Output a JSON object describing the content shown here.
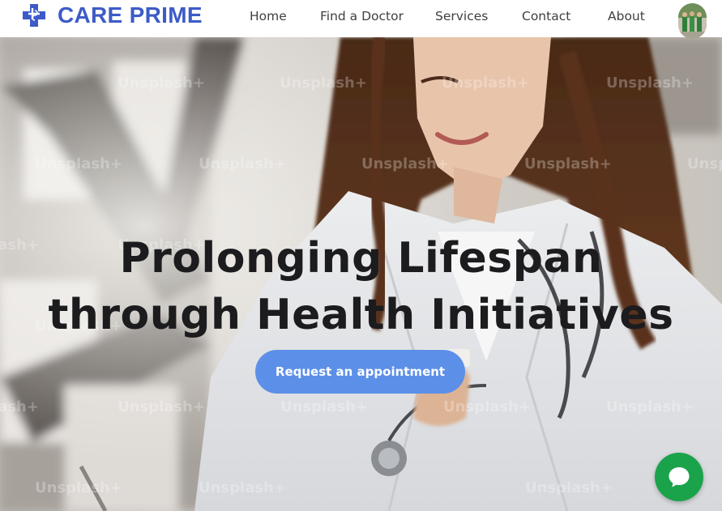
{
  "brand": {
    "name": "CARE PRIME",
    "logo_icon": "medical-cross-icon",
    "color": "#3d5bc7"
  },
  "nav": {
    "items": [
      {
        "label": "Home"
      },
      {
        "label": "Find a Doctor"
      },
      {
        "label": "Services"
      },
      {
        "label": "Contact"
      },
      {
        "label": "About"
      }
    ],
    "avatar_icon": "profile-avatar"
  },
  "hero": {
    "background": "photo-doctor-with-stethoscope",
    "watermark": "Unsplash+",
    "headline_line1": "Prolonging Lifespan",
    "headline_line2": "through Health Initiatives",
    "cta_label": "Request an appointment",
    "cta_color": "#5c8fe8"
  },
  "chat": {
    "icon": "chat-bubble-icon",
    "color": "#1aa34a"
  }
}
